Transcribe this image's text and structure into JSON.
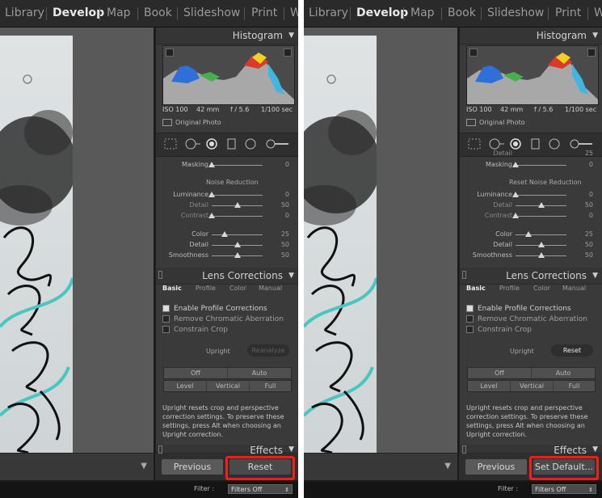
{
  "nav": {
    "items": [
      "Library",
      "Develop",
      "Map",
      "Book",
      "Slideshow",
      "Print",
      "We"
    ],
    "active_index": 1
  },
  "panels": {
    "histogram_title": "Histogram",
    "exif": {
      "iso": "ISO 100",
      "focal": "42 mm",
      "aperture": "f / 5.6",
      "shutter": "1/100 sec"
    },
    "original_photo": "Original Photo",
    "masking_label": "Masking",
    "masking_value": "0",
    "lens_corrections_title": "Lens Corrections",
    "tabs": [
      "Basic",
      "Profile",
      "Color",
      "Manual"
    ],
    "enable_profile": "Enable Profile Corrections",
    "remove_ca": "Remove Chromatic Aberration",
    "constrain_crop": "Constrain Crop",
    "upright_label": "Upright",
    "seg_row1": [
      "Off",
      "Auto"
    ],
    "seg_row2": [
      "Level",
      "Vertical",
      "Full"
    ],
    "info_lines": [
      "Upright resets crop and perspective",
      "correction settings. To preserve these",
      "settings, press Alt when choosing an",
      "Upright correction."
    ],
    "effects_title": "Effects",
    "previous_label": "Previous",
    "filter_label": "Filter :",
    "filter_value": "Filters Off"
  },
  "left": {
    "noise_header": "Noise Reduction",
    "sliders": [
      {
        "label": "Luminance",
        "value": "0",
        "pos": 0,
        "dim": false
      },
      {
        "label": "Detail",
        "value": "50",
        "pos": 0.5,
        "dim": true
      },
      {
        "label": "Contrast",
        "value": "0",
        "pos": 0,
        "dim": true
      },
      {
        "label": "Color",
        "value": "25",
        "pos": 0.25,
        "dim": false
      },
      {
        "label": "Detail",
        "value": "50",
        "pos": 0.5,
        "dim": false
      },
      {
        "label": "Smoothness",
        "value": "50",
        "pos": 0.5,
        "dim": false
      }
    ],
    "upright_action": "Reanalyze",
    "action_button": "Reset"
  },
  "right": {
    "noise_header": "Reset Noise Reduction",
    "detail_top_label": "Detail",
    "detail_top_value": "25",
    "sliders": [
      {
        "label": "Luminance",
        "value": "0",
        "pos": 0,
        "dim": false
      },
      {
        "label": "Detail",
        "value": "50",
        "pos": 0.5,
        "dim": true
      },
      {
        "label": "Contrast",
        "value": "0",
        "pos": 0,
        "dim": true
      },
      {
        "label": "Color",
        "value": "25",
        "pos": 0.25,
        "dim": false
      },
      {
        "label": "Detail",
        "value": "50",
        "pos": 0.5,
        "dim": false
      },
      {
        "label": "Smoothness",
        "value": "50",
        "pos": 0.5,
        "dim": false
      }
    ],
    "upright_action": "Reset",
    "action_button": "Set Default..."
  },
  "colors": {
    "highlight": "#ff1a1a",
    "panel_bg": "#3a3a3a",
    "nav_bg": "#2a2a2a"
  }
}
